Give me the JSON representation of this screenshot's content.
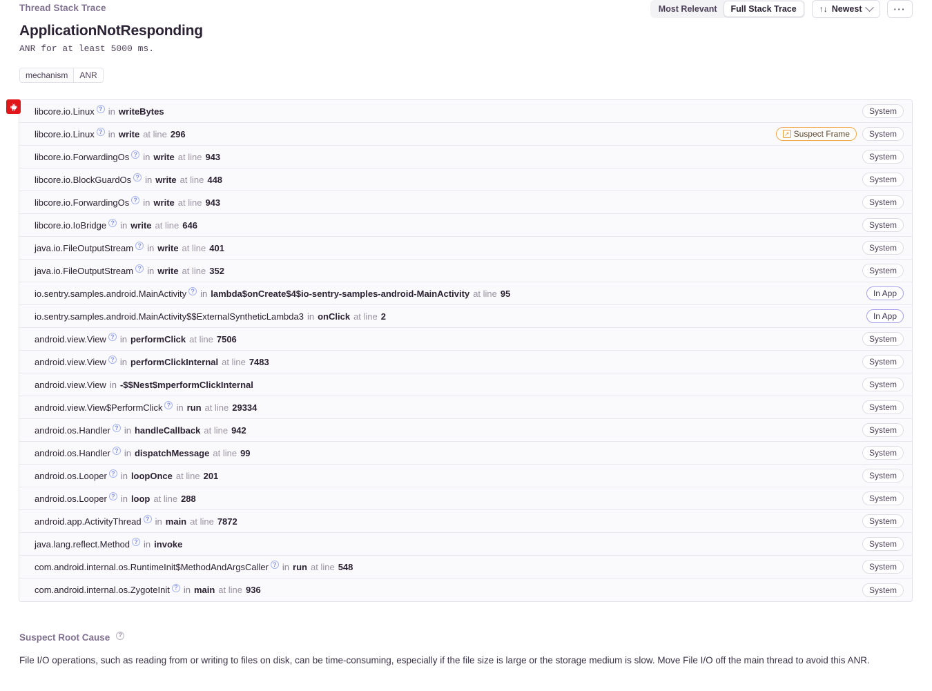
{
  "header": {
    "section_label": "Thread Stack Trace",
    "segmented": [
      {
        "label": "Most Relevant",
        "selected": false
      },
      {
        "label": "Full Stack Trace",
        "selected": true
      }
    ],
    "sort": {
      "icon": "sort-arrows-icon",
      "label": "Newest",
      "chevron": "chevron-down-icon"
    },
    "overflow": {
      "icon": "ellipsis-icon",
      "label": "···"
    }
  },
  "issue": {
    "title": "ApplicationNotResponding",
    "subtitle": "ANR for at least 5000 ms.",
    "tags": [
      {
        "key": "mechanism",
        "value": "ANR"
      }
    ]
  },
  "platform_badge": {
    "icon": "android-platform-icon",
    "color": "#e1161b"
  },
  "frames_meta": {
    "in_label": "in",
    "at_line_label": "at line",
    "help_icon": "question-mark-circle-icon",
    "suspect_icon": "external-link-box-icon"
  },
  "frames": [
    {
      "module": "libcore.io.Linux",
      "help": true,
      "func": "writeBytes",
      "line": "",
      "badge": "System",
      "badge_type": "system",
      "suspect": false
    },
    {
      "module": "libcore.io.Linux",
      "help": true,
      "func": "write",
      "line": "296",
      "badge": "System",
      "badge_type": "system",
      "suspect": true,
      "suspect_label": "Suspect Frame"
    },
    {
      "module": "libcore.io.ForwardingOs",
      "help": true,
      "func": "write",
      "line": "943",
      "badge": "System",
      "badge_type": "system",
      "suspect": false
    },
    {
      "module": "libcore.io.BlockGuardOs",
      "help": true,
      "func": "write",
      "line": "448",
      "badge": "System",
      "badge_type": "system",
      "suspect": false
    },
    {
      "module": "libcore.io.ForwardingOs",
      "help": true,
      "func": "write",
      "line": "943",
      "badge": "System",
      "badge_type": "system",
      "suspect": false
    },
    {
      "module": "libcore.io.IoBridge",
      "help": true,
      "func": "write",
      "line": "646",
      "badge": "System",
      "badge_type": "system",
      "suspect": false
    },
    {
      "module": "java.io.FileOutputStream",
      "help": true,
      "func": "write",
      "line": "401",
      "badge": "System",
      "badge_type": "system",
      "suspect": false
    },
    {
      "module": "java.io.FileOutputStream",
      "help": true,
      "func": "write",
      "line": "352",
      "badge": "System",
      "badge_type": "system",
      "suspect": false
    },
    {
      "module": "io.sentry.samples.android.MainActivity",
      "help": true,
      "func": "lambda$onCreate$4$io-sentry-samples-android-MainActivity",
      "line": "95",
      "badge": "In App",
      "badge_type": "inapp",
      "suspect": false
    },
    {
      "module": "io.sentry.samples.android.MainActivity$$ExternalSyntheticLambda3",
      "help": false,
      "func": "onClick",
      "line": "2",
      "badge": "In App",
      "badge_type": "inapp",
      "suspect": false
    },
    {
      "module": "android.view.View",
      "help": true,
      "func": "performClick",
      "line": "7506",
      "badge": "System",
      "badge_type": "system",
      "suspect": false
    },
    {
      "module": "android.view.View",
      "help": true,
      "func": "performClickInternal",
      "line": "7483",
      "badge": "System",
      "badge_type": "system",
      "suspect": false
    },
    {
      "module": "android.view.View",
      "help": false,
      "func": "-$$Nest$mperformClickInternal",
      "line": "",
      "badge": "System",
      "badge_type": "system",
      "suspect": false
    },
    {
      "module": "android.view.View$PerformClick",
      "help": true,
      "func": "run",
      "line": "29334",
      "badge": "System",
      "badge_type": "system",
      "suspect": false
    },
    {
      "module": "android.os.Handler",
      "help": true,
      "func": "handleCallback",
      "line": "942",
      "badge": "System",
      "badge_type": "system",
      "suspect": false
    },
    {
      "module": "android.os.Handler",
      "help": true,
      "func": "dispatchMessage",
      "line": "99",
      "badge": "System",
      "badge_type": "system",
      "suspect": false
    },
    {
      "module": "android.os.Looper",
      "help": true,
      "func": "loopOnce",
      "line": "201",
      "badge": "System",
      "badge_type": "system",
      "suspect": false
    },
    {
      "module": "android.os.Looper",
      "help": true,
      "func": "loop",
      "line": "288",
      "badge": "System",
      "badge_type": "system",
      "suspect": false
    },
    {
      "module": "android.app.ActivityThread",
      "help": true,
      "func": "main",
      "line": "7872",
      "badge": "System",
      "badge_type": "system",
      "suspect": false
    },
    {
      "module": "java.lang.reflect.Method",
      "help": true,
      "func": "invoke",
      "line": "",
      "badge": "System",
      "badge_type": "system",
      "suspect": false
    },
    {
      "module": "com.android.internal.os.RuntimeInit$MethodAndArgsCaller",
      "help": true,
      "func": "run",
      "line": "548",
      "badge": "System",
      "badge_type": "system",
      "suspect": false
    },
    {
      "module": "com.android.internal.os.ZygoteInit",
      "help": true,
      "func": "main",
      "line": "936",
      "badge": "System",
      "badge_type": "system",
      "suspect": false
    }
  ],
  "root_cause": {
    "heading": "Suspect Root Cause",
    "help_icon": "question-mark-circle-icon",
    "text": "File I/O operations, such as reading from or writing to files on disk, can be time-consuming, especially if the file size is large or the storage medium is slow. Move File I/O off the main thread to avoid this ANR."
  },
  "colors": {
    "platform_badge": "#e1161b",
    "suspect_accent": "#e59a33",
    "inapp_accent": "#a6a0e8",
    "row_bg": "#faf9fb"
  }
}
